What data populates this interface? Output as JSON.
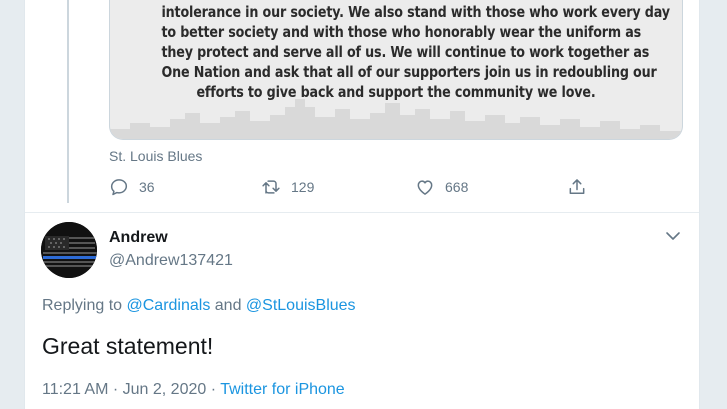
{
  "quoted_tweet": {
    "statement_lines": [
      "intolerance in our society. We also stand with those who work every day",
      "to better society and with those who honorably wear the uniform as",
      "they protect and serve all of us. We will continue to work together as",
      "One Nation and ask that all of our supporters join us in redoubling our",
      "efforts to give back and support the community we love."
    ],
    "source": "St. Louis Blues",
    "actions": {
      "reply_count": "36",
      "retweet_count": "129",
      "like_count": "668"
    },
    "icons": [
      "reply-icon",
      "retweet-icon",
      "like-icon",
      "share-icon"
    ]
  },
  "tweet": {
    "display_name": "Andrew",
    "handle": "@Andrew137421",
    "replying_prefix": "Replying to ",
    "mention_1": "@Cardinals",
    "replying_and": " and ",
    "mention_2": "@StLouisBlues",
    "text": "Great statement!",
    "time": "11:21 AM",
    "dot_1": " · ",
    "date": "Jun 2, 2020",
    "dot_2": " · ",
    "client": "Twitter for iPhone"
  },
  "colors": {
    "accent": "#1b95e0",
    "secondary_text": "#657786",
    "primary_text": "#14171a",
    "background": "#e6ecf0"
  }
}
